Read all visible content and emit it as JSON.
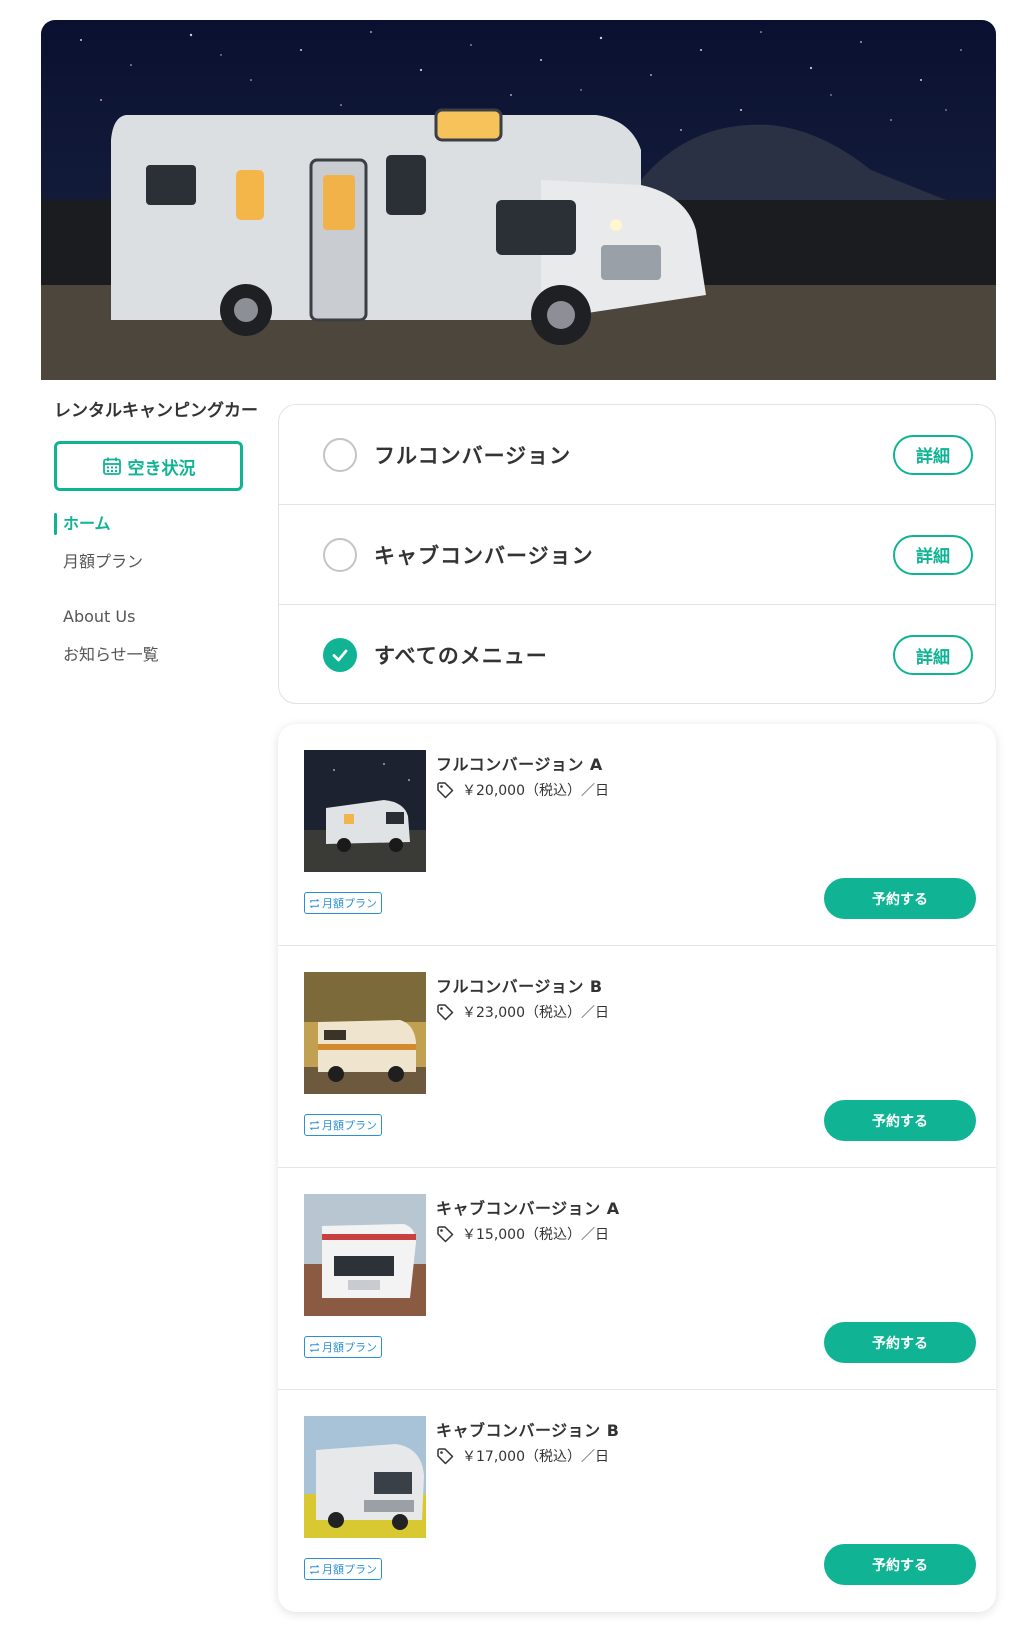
{
  "brand": "レンタルキャンピングカー",
  "availability_button": {
    "label": "空き状況",
    "icon": "calendar-icon"
  },
  "nav": {
    "items": [
      {
        "label": "ホーム",
        "active": true
      },
      {
        "label": "月額プラン",
        "active": false
      },
      {
        "label": "About Us",
        "active": false
      },
      {
        "label": "お知らせ一覧",
        "active": false
      }
    ]
  },
  "filters": [
    {
      "label": "フルコンバージョン",
      "selected": false,
      "detail_label": "詳細"
    },
    {
      "label": "キャブコンバージョン",
      "selected": false,
      "detail_label": "詳細"
    },
    {
      "label": "すべてのメニュー",
      "selected": true,
      "detail_label": "詳細"
    }
  ],
  "vehicles": [
    {
      "name": "フルコンバージョン A",
      "price": "￥20,000（税込）／日",
      "badge": "月額プラン",
      "reserve_label": "予約する"
    },
    {
      "name": "フルコンバージョン B",
      "price": "￥23,000（税込）／日",
      "badge": "月額プラン",
      "reserve_label": "予約する"
    },
    {
      "name": "キャブコンバージョン A",
      "price": "￥15,000（税込）／日",
      "badge": "月額プラン",
      "reserve_label": "予約する"
    },
    {
      "name": "キャブコンバージョン B",
      "price": "￥17,000（税込）／日",
      "badge": "月額プラン",
      "reserve_label": "予約する"
    }
  ],
  "colors": {
    "accent": "#10b394",
    "badge": "#2b8fd6",
    "text": "#333333"
  }
}
